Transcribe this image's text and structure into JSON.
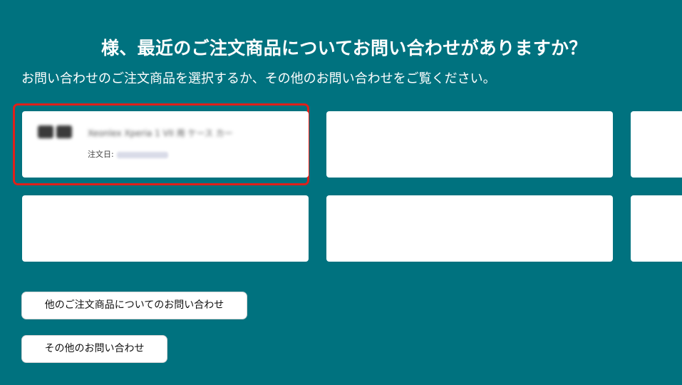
{
  "header": {
    "title": "様、最近のご注文商品についてお問い合わせがありますか？",
    "subtitle": "お問い合わせのご注文商品を選択するか、その他のお問い合わせをご覧ください。"
  },
  "orders": [
    {
      "item_name": "Xeonlex Xperia 1 VII 用 ケース カー",
      "date_label": "注文日:",
      "selected": true
    },
    {
      "item_name": "",
      "date_label": ""
    },
    {
      "item_name": "",
      "date_label": ""
    },
    {
      "item_name": "",
      "date_label": ""
    },
    {
      "item_name": "",
      "date_label": ""
    },
    {
      "item_name": "",
      "date_label": ""
    }
  ],
  "actions": {
    "other_order_label": "他のご注文商品についてのお問い合わせ",
    "other_inquiry_label": "その他のお問い合わせ"
  },
  "colors": {
    "background": "#00727f",
    "highlight": "#e0201a",
    "card": "#ffffff"
  }
}
